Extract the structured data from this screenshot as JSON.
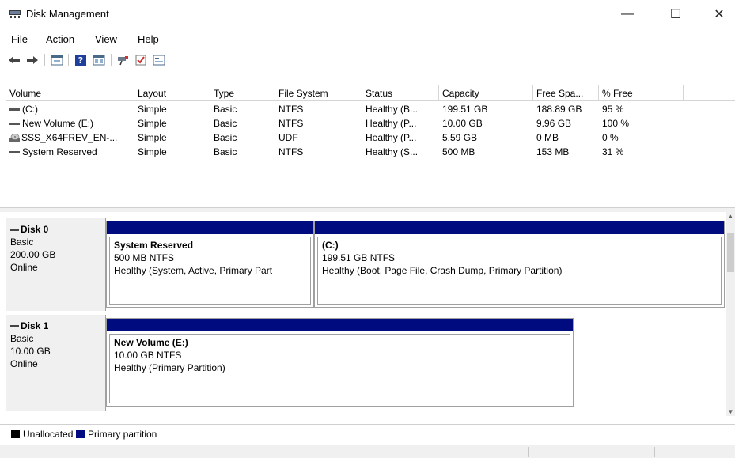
{
  "window": {
    "title": "Disk Management",
    "icon": "disk-management-icon",
    "controls": {
      "minimize": "—",
      "maximize": "☐",
      "close": "✕"
    }
  },
  "menu": [
    "File",
    "Action",
    "View",
    "Help"
  ],
  "toolbar": {
    "icons": [
      "back-icon",
      "forward-icon",
      "properties-icon",
      "help-icon",
      "view-icon",
      "connect-icon",
      "check-icon",
      "console-icon"
    ]
  },
  "volume_list": {
    "columns": [
      "Volume",
      "Layout",
      "Type",
      "File System",
      "Status",
      "Capacity",
      "Free Spa...",
      "% Free"
    ],
    "rows": [
      {
        "icon": "drive-icon",
        "cells": [
          "(C:)",
          "Simple",
          "Basic",
          "NTFS",
          "Healthy (B...",
          "199.51 GB",
          "188.89 GB",
          "95 %"
        ]
      },
      {
        "icon": "drive-icon",
        "cells": [
          "New Volume (E:)",
          "Simple",
          "Basic",
          "NTFS",
          "Healthy (P...",
          "10.00 GB",
          "9.96 GB",
          "100 %"
        ]
      },
      {
        "icon": "cd-drive-icon",
        "cells": [
          "SSS_X64FREV_EN-...",
          "Simple",
          "Basic",
          "UDF",
          "Healthy (P...",
          "5.59 GB",
          "0 MB",
          "0 %"
        ]
      },
      {
        "icon": "drive-icon",
        "cells": [
          "System Reserved",
          "Simple",
          "Basic",
          "NTFS",
          "Healthy (S...",
          "500 MB",
          "153 MB",
          "31 %"
        ]
      }
    ]
  },
  "disks": [
    {
      "title": "Disk 0",
      "type": "Basic",
      "size": "200.00 GB",
      "state": "Online",
      "partitions": [
        {
          "name": "System Reserved",
          "size_fs": "500 MB NTFS",
          "status": "Healthy (System, Active, Primary Part"
        },
        {
          "name": "(C:)",
          "size_fs": "199.51 GB NTFS",
          "status": "Healthy (Boot, Page File, Crash Dump, Primary Partition)"
        }
      ]
    },
    {
      "title": "Disk 1",
      "type": "Basic",
      "size": "10.00 GB",
      "state": "Online",
      "partitions": [
        {
          "name": "New Volume  (E:)",
          "size_fs": "10.00 GB NTFS",
          "status": "Healthy (Primary Partition)"
        }
      ]
    }
  ],
  "legend": [
    {
      "label": "Unallocated",
      "color": "#000000"
    },
    {
      "label": "Primary partition",
      "color": "#000b80"
    }
  ],
  "colors": {
    "primary_partition": "#000b80",
    "unallocated": "#000000"
  }
}
